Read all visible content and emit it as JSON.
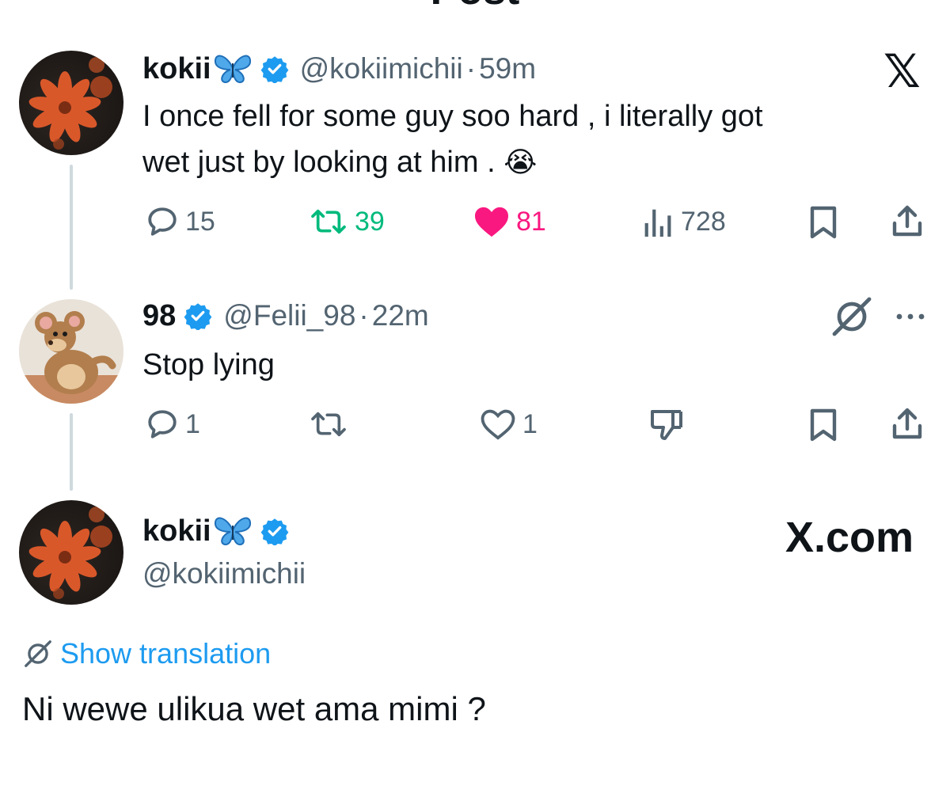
{
  "header": {
    "title": "Post"
  },
  "tweet1": {
    "display_name": "kokii",
    "handle": "@kokiimichii",
    "separator": "·",
    "time": "59m",
    "text_line1": "I once fell for some guy soo hard , i literally got",
    "text_line2": "wet just by looking at him .",
    "emoji": "😭",
    "actions": {
      "replies": "15",
      "reposts": "39",
      "likes": "81",
      "views": "728"
    }
  },
  "tweet2": {
    "display_name": "98",
    "handle": "@Felii_98",
    "separator": "·",
    "time": "22m",
    "text": "Stop lying",
    "actions": {
      "replies": "1",
      "likes": "1"
    }
  },
  "tweet3": {
    "display_name": "kokii",
    "handle": "@kokiimichii",
    "show_translation": "Show translation",
    "text": "Ni wewe ulikua wet ama mimi ?"
  },
  "brand": {
    "x_logo": "𝕏",
    "x_com": "X.com"
  },
  "colors": {
    "accent_blue": "#1d9bf0",
    "repost_green": "#00ba7c",
    "like_pink": "#f91880",
    "secondary_gray": "#536471",
    "thread_line": "#cfd9de"
  },
  "icons": {
    "reply": "reply-icon",
    "repost": "repost-icon",
    "like": "heart-icon",
    "views": "views-icon",
    "bookmark": "bookmark-icon",
    "share": "share-icon",
    "dislike": "dislike-icon",
    "grok": "grok-icon",
    "more": "more-icon",
    "verified": "verified-badge-icon",
    "butterfly": "butterfly-icon"
  }
}
